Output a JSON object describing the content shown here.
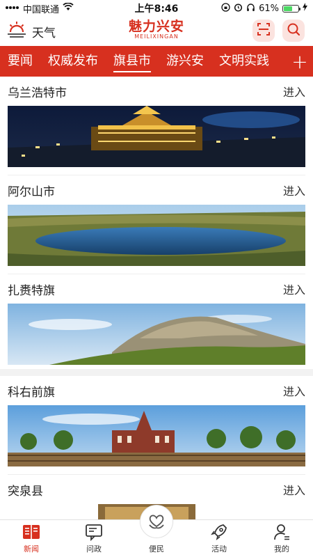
{
  "status_bar": {
    "carrier": "中国联通",
    "time": "上午8:46",
    "battery_percent": "61%",
    "battery_level": 0.61
  },
  "header": {
    "weather_label": "天气",
    "logo_cn": "魅力兴安",
    "logo_en": "MEILIXINGAN"
  },
  "tabs": {
    "items": [
      "要闻",
      "权威发布",
      "旗县市",
      "游兴安",
      "文明实践"
    ],
    "active_index": 2,
    "more_label": "+"
  },
  "regions": [
    {
      "name": "乌兰浩特市",
      "action": "进入"
    },
    {
      "name": "阿尔山市",
      "action": "进入"
    },
    {
      "name": "扎赉特旗",
      "action": "进入"
    },
    {
      "name": "科右前旗",
      "action": "进入"
    },
    {
      "name": "突泉县",
      "action": "进入"
    }
  ],
  "bottom_nav": {
    "items": [
      "新闻",
      "问政",
      "便民",
      "活动",
      "我的"
    ],
    "active_index": 0
  },
  "colors": {
    "brand": "#d7301f",
    "tab_bg": "#d7301f"
  }
}
